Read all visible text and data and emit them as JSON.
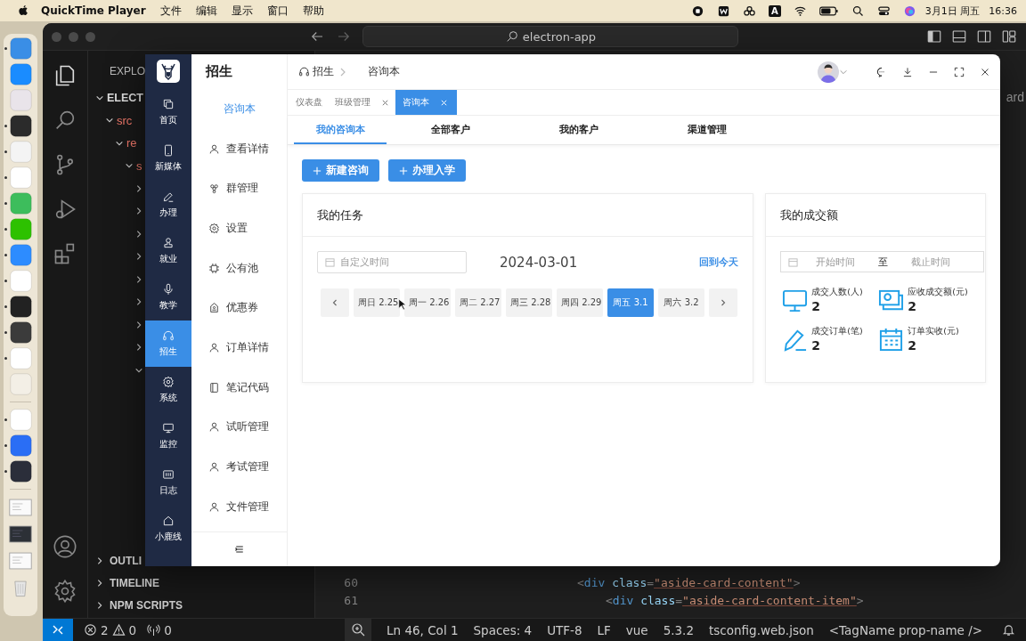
{
  "menubar": {
    "app": "QuickTime Player",
    "menus": [
      "文件",
      "编辑",
      "显示",
      "窗口",
      "帮助"
    ],
    "input_source": "A",
    "date": "3月1日 周五",
    "time": "16:36"
  },
  "dock": {
    "apps": [
      {
        "color": "#3a8ee6",
        "running": true
      },
      {
        "color": "#1a8cff",
        "running": false
      },
      {
        "color": "#e9e4ea",
        "running": false
      },
      {
        "color": "#2b2b2b",
        "running": true
      },
      {
        "color": "#f4f4f4",
        "running": true
      },
      {
        "color": "#ffffff",
        "running": true
      },
      {
        "color": "#3dbd5c",
        "running": true
      },
      {
        "color": "#2dc100",
        "running": true
      },
      {
        "color": "#2d8cff",
        "running": true
      },
      {
        "color": "#ffffff",
        "running": true
      },
      {
        "color": "#222222",
        "running": true
      },
      {
        "color": "#3b3b3b",
        "running": true
      },
      {
        "color": "#ffffff",
        "running": true
      },
      {
        "color": "#f3efe6",
        "running": false
      }
    ],
    "recent_apps": [
      {
        "color": "#ffffff",
        "running": true
      },
      {
        "color": "#2a6ef5",
        "running": true
      },
      {
        "color": "#2b2e3a",
        "running": true
      }
    ],
    "documents": [
      {
        "kind": "light"
      },
      {
        "kind": "dark"
      },
      {
        "kind": "light"
      }
    ]
  },
  "vscode": {
    "command_center": "electron-app",
    "explorer_title": "EXPLO",
    "tree": [
      {
        "label": "ELECT",
        "expanded": true,
        "children": [
          {
            "label": "src",
            "expanded": true,
            "children": [
              {
                "label": "re",
                "expanded": true,
                "children": [
                  {
                    "label": "s",
                    "expanded": true,
                    "children": [
                      {
                        "expanded": false
                      },
                      {
                        "expanded": false
                      },
                      {
                        "expanded": false
                      },
                      {
                        "expanded": false
                      },
                      {
                        "expanded": false
                      },
                      {
                        "expanded": false
                      },
                      {
                        "expanded": false
                      },
                      {
                        "expanded": false
                      },
                      {
                        "expanded": true
                      }
                    ]
                  }
                ]
              }
            ]
          }
        ]
      }
    ],
    "sections": [
      {
        "label": "OUTLI",
        "expanded": false
      },
      {
        "label": "TIMELINE",
        "expanded": false
      },
      {
        "label": "NPM SCRIPTS",
        "expanded": false
      }
    ],
    "editor_tab": "ard",
    "code": [
      {
        "number": "60",
        "tokens": [
          {
            "kind": "punct",
            "text": "<"
          },
          {
            "kind": "tag",
            "text": "div"
          },
          {
            "kind": "attr",
            "text": " class"
          },
          {
            "kind": "punct",
            "text": "="
          },
          {
            "kind": "string",
            "text": "\"aside-card-content\""
          },
          {
            "kind": "punct",
            "text": ">"
          }
        ]
      },
      {
        "number": "61",
        "tokens": [
          {
            "kind": "punct",
            "text": "<"
          },
          {
            "kind": "tag",
            "text": "div"
          },
          {
            "kind": "attr",
            "text": " class"
          },
          {
            "kind": "punct",
            "text": "="
          },
          {
            "kind": "string",
            "text": "\"aside-card-content-item\""
          },
          {
            "kind": "punct",
            "text": ">"
          }
        ]
      }
    ],
    "status": {
      "errors": "2",
      "warnings": "0",
      "ports": "0",
      "items": [
        "Ln 46, Col 1",
        "Spaces: 4",
        "UTF-8",
        "LF",
        "vue",
        "5.3.2",
        "tsconfig.web.json",
        "<TagName prop-name />"
      ]
    }
  },
  "app": {
    "rail": [
      {
        "label": "首页",
        "selected": false
      },
      {
        "label": "新媒体",
        "selected": false
      },
      {
        "label": "办理",
        "selected": false
      },
      {
        "label": "就业",
        "selected": false
      },
      {
        "label": "教学",
        "selected": false
      },
      {
        "label": "招生",
        "selected": true
      },
      {
        "label": "系统",
        "selected": false
      },
      {
        "label": "监控",
        "selected": false
      },
      {
        "label": "日志",
        "selected": false
      },
      {
        "label": "小鹿线",
        "selected": false
      }
    ],
    "section_title": "招生",
    "menu": [
      {
        "label": "咨询本",
        "selected": true
      },
      {
        "label": "查看详情",
        "selected": false
      },
      {
        "label": "群管理",
        "selected": false
      },
      {
        "label": "设置",
        "selected": false
      },
      {
        "label": "公有池",
        "selected": false
      },
      {
        "label": "优惠券",
        "selected": false
      },
      {
        "label": "订单详情",
        "selected": false
      },
      {
        "label": "笔记代码",
        "selected": false
      },
      {
        "label": "试听管理",
        "selected": false
      },
      {
        "label": "考试管理",
        "selected": false
      },
      {
        "label": "文件管理",
        "selected": false
      }
    ],
    "breadcrumb": [
      "招生",
      "咨询本"
    ],
    "tabs": [
      {
        "label": "仪表盘",
        "selected": false,
        "closable": false
      },
      {
        "label": "班级管理",
        "selected": false,
        "closable": true
      },
      {
        "label": "咨询本",
        "selected": true,
        "closable": true
      }
    ],
    "subtabs": [
      {
        "label": "我的咨询本",
        "selected": true
      },
      {
        "label": "全部客户",
        "selected": false
      },
      {
        "label": "我的客户",
        "selected": false
      },
      {
        "label": "渠道管理",
        "selected": false
      }
    ],
    "buttons": [
      "新建咨询",
      "办理入学"
    ],
    "tasks": {
      "title": "我的任务",
      "date_placeholder": "自定义时间",
      "date": "2024-03-01",
      "today_link": "回到今天",
      "days": [
        {
          "label": "周日 2.25",
          "selected": false
        },
        {
          "label": "周一 2.26",
          "selected": false
        },
        {
          "label": "周二 2.27",
          "selected": false
        },
        {
          "label": "周三 2.28",
          "selected": false
        },
        {
          "label": "周四 2.29",
          "selected": false
        },
        {
          "label": "周五 3.1",
          "selected": true
        },
        {
          "label": "周六 3.2",
          "selected": false
        }
      ]
    },
    "deals": {
      "title": "我的成交额",
      "start_placeholder": "开始时间",
      "separator": "至",
      "end_placeholder": "截止时间",
      "stats": [
        {
          "label": "成交人数(人)",
          "value": "2"
        },
        {
          "label": "应收成交额(元)",
          "value": "2"
        },
        {
          "label": "成交订单(笔)",
          "value": "2"
        },
        {
          "label": "订单实收(元)",
          "value": "2"
        }
      ]
    }
  }
}
